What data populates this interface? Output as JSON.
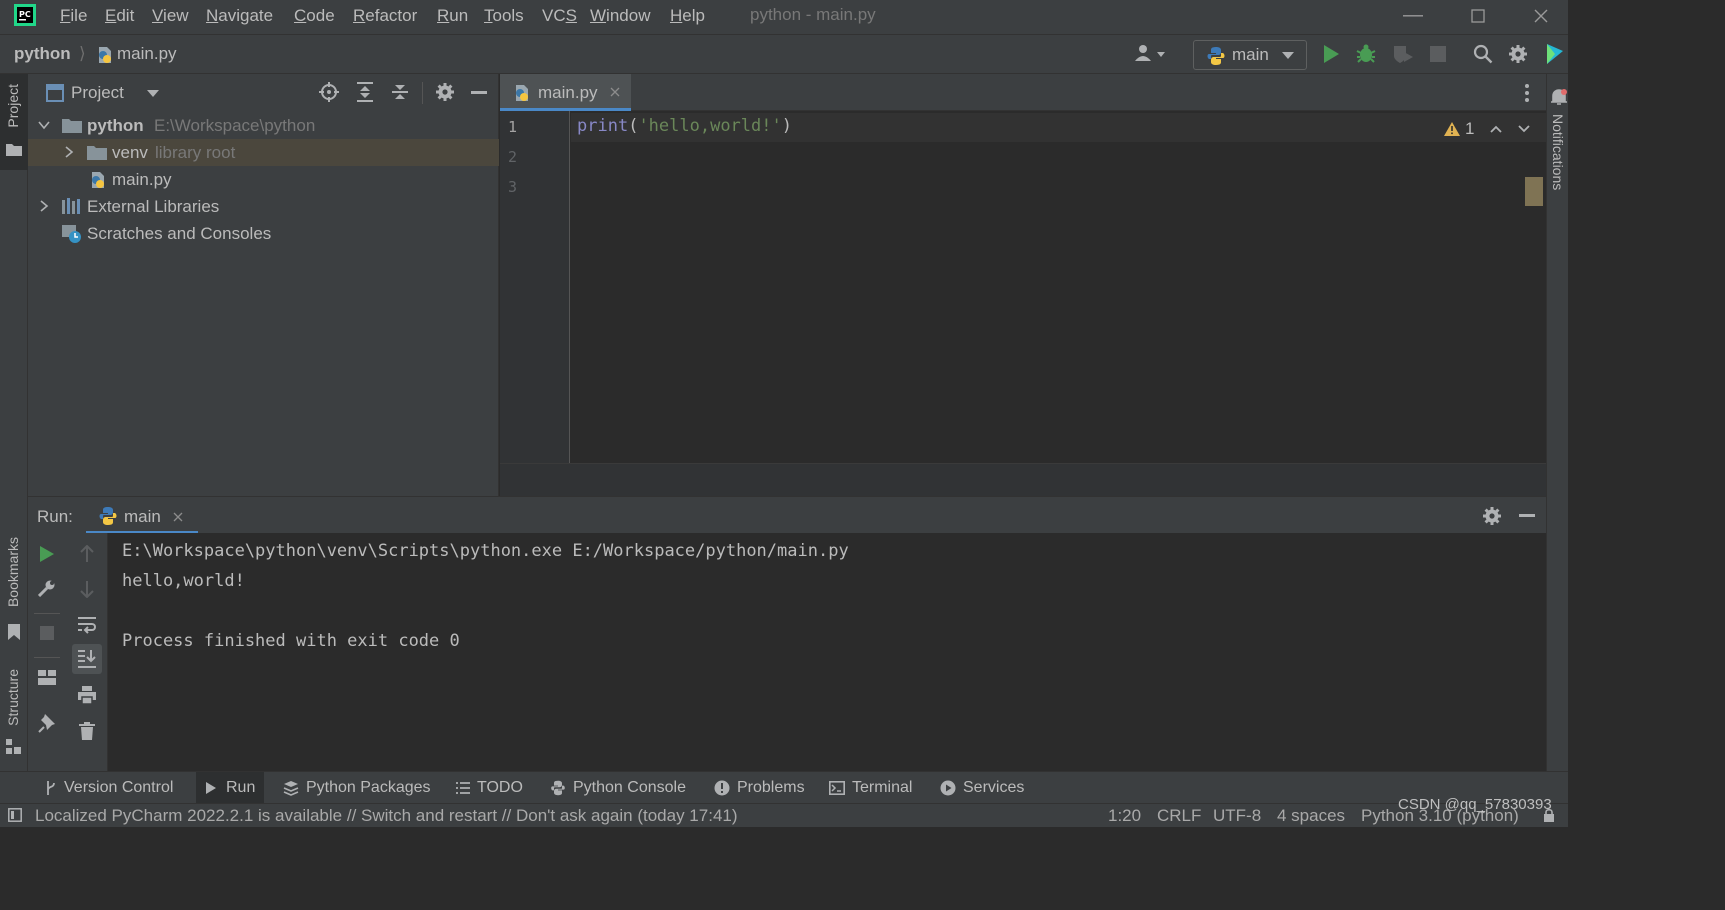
{
  "titlebar": {
    "menu": [
      {
        "pre": "",
        "u": "F",
        "post": "ile"
      },
      {
        "pre": "",
        "u": "E",
        "post": "dit"
      },
      {
        "pre": "",
        "u": "V",
        "post": "iew"
      },
      {
        "pre": "",
        "u": "N",
        "post": "avigate"
      },
      {
        "pre": "",
        "u": "C",
        "post": "ode"
      },
      {
        "pre": "",
        "u": "R",
        "post": "efactor"
      },
      {
        "pre": "",
        "u": "R",
        "post": "un"
      },
      {
        "pre": "",
        "u": "T",
        "post": "ools"
      },
      {
        "pre": "VC",
        "u": "S",
        "post": ""
      },
      {
        "pre": "",
        "u": "W",
        "post": "indow"
      },
      {
        "pre": "",
        "u": "H",
        "post": "elp"
      }
    ],
    "window_title": "python - main.py"
  },
  "navbar": {
    "breadcrumb_project": "python",
    "breadcrumb_file": "main.py",
    "run_config": "main"
  },
  "left_stripe": {
    "project": "Project",
    "bookmarks": "Bookmarks",
    "structure": "Structure"
  },
  "right_stripe": {
    "notifications": "Notifications"
  },
  "project_panel": {
    "title": "Project",
    "tree": [
      {
        "name": "python",
        "hint": "E:\\Workspace\\python"
      },
      {
        "name": "venv",
        "hint": "library root"
      },
      {
        "name": "main.py",
        "hint": ""
      },
      {
        "name": "External Libraries",
        "hint": ""
      },
      {
        "name": "Scratches and Consoles",
        "hint": ""
      }
    ]
  },
  "editor": {
    "tab": "main.py",
    "line_numbers": [
      "1",
      "2",
      "3"
    ],
    "code_func": "print",
    "code_open": "(",
    "code_str": "'hello,world!'",
    "code_close": ")",
    "warning_count": "1"
  },
  "run_panel": {
    "label": "Run:",
    "tab": "main",
    "console": [
      "E:\\Workspace\\python\\venv\\Scripts\\python.exe E:/Workspace/python/main.py",
      "hello,world!",
      "",
      "Process finished with exit code 0"
    ]
  },
  "tool_windows": [
    "Version Control",
    "Run",
    "Python Packages",
    "TODO",
    "Python Console",
    "Problems",
    "Terminal",
    "Services"
  ],
  "statusbar": {
    "message": "Localized PyCharm 2022.2.1 is available // Switch and restart // Don't ask again (today 17:41)",
    "position": "1:20",
    "line_sep": "CRLF",
    "encoding": "UTF-8",
    "indent": "4 spaces",
    "interpreter": "Python 3.10 (python)"
  },
  "watermark": "CSDN @qq_57830393",
  "colors": {
    "accent_green": "#499c54",
    "keyword_func": "#8888c6",
    "string": "#6a8759",
    "warning": "#e0b252"
  }
}
